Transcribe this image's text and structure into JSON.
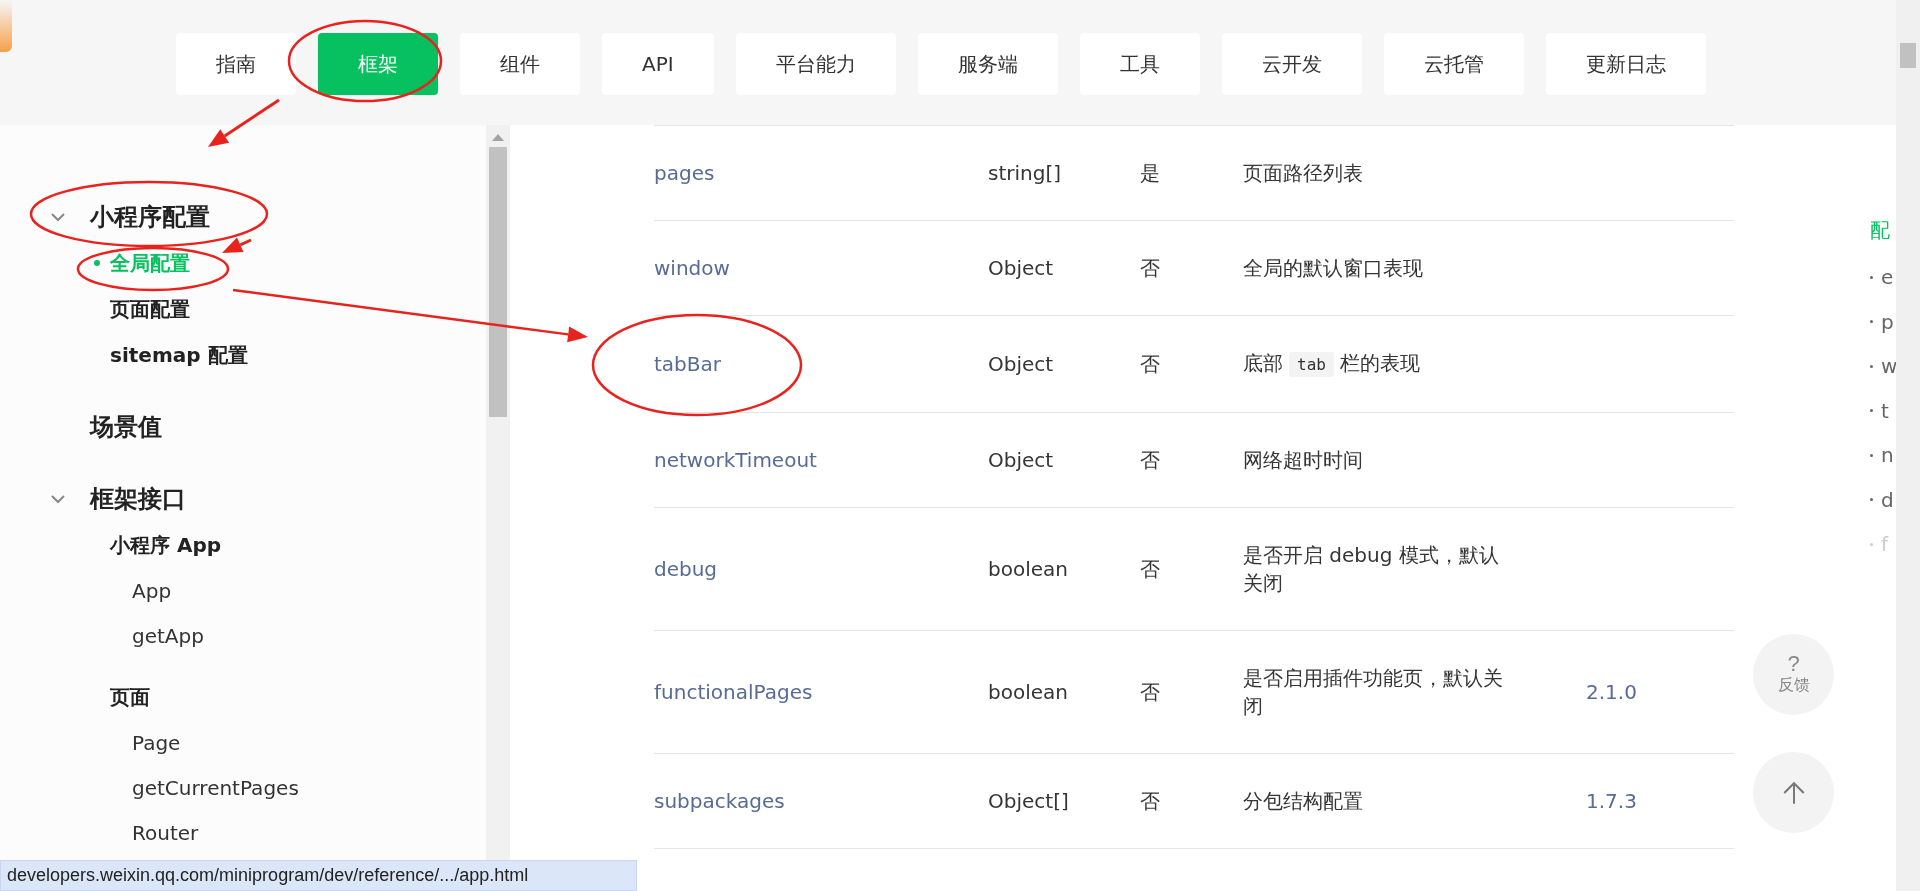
{
  "nav": {
    "tabs": [
      {
        "label": "指南",
        "selected": false
      },
      {
        "label": "框架",
        "selected": true
      },
      {
        "label": "组件",
        "selected": false
      },
      {
        "label": "API",
        "selected": false
      },
      {
        "label": "平台能力",
        "selected": false
      },
      {
        "label": "服务端",
        "selected": false
      },
      {
        "label": "工具",
        "selected": false
      },
      {
        "label": "云开发",
        "selected": false
      },
      {
        "label": "云托管",
        "selected": false
      },
      {
        "label": "更新日志",
        "selected": false
      }
    ]
  },
  "sidebar": {
    "sections": [
      {
        "label": "小程序配置",
        "kind": "folder",
        "expanded": true,
        "children": [
          {
            "label": "全局配置",
            "selected": true
          },
          {
            "label": "页面配置",
            "selected": false
          },
          {
            "label": "sitemap 配置",
            "selected": false
          }
        ]
      },
      {
        "label": "场景值",
        "kind": "page"
      },
      {
        "label": "框架接口",
        "kind": "folder",
        "expanded": true,
        "children": [
          {
            "label": "小程序 App",
            "selected": false,
            "children": [
              {
                "label": "App",
                "selected": false
              },
              {
                "label": "getApp",
                "selected": false
              }
            ]
          },
          {
            "label": "页面",
            "selected": false,
            "children": [
              {
                "label": "Page",
                "selected": false
              },
              {
                "label": "getCurrentPages",
                "selected": false
              },
              {
                "label": "Router",
                "selected": false
              }
            ]
          }
        ]
      }
    ]
  },
  "table": {
    "rows": [
      {
        "name": "pages",
        "type": "string[]",
        "required": "是",
        "description": [
          {
            "kind": "text",
            "text": "页面路径列表"
          }
        ]
      },
      {
        "name": "window",
        "type": "Object",
        "required": "否",
        "description": [
          {
            "kind": "text",
            "text": "全局的默认窗口表现"
          }
        ]
      },
      {
        "name": "tabBar",
        "type": "Object",
        "required": "否",
        "description": [
          {
            "kind": "text",
            "text": "底部"
          },
          {
            "kind": "code",
            "text": "tab"
          },
          {
            "kind": "text",
            "text": "栏的表现"
          }
        ]
      },
      {
        "name": "networkTimeout",
        "type": "Object",
        "required": "否",
        "description": [
          {
            "kind": "text",
            "text": "网络超时时间"
          }
        ]
      },
      {
        "name": "debug",
        "type": "boolean",
        "required": "否",
        "description": [
          {
            "kind": "text",
            "text": "是否开启 debug 模式，默认关闭"
          }
        ]
      },
      {
        "name": "functionalPages",
        "type": "boolean",
        "required": "否",
        "description": [
          {
            "kind": "text",
            "text": "是否启用插件功能页，默认关闭"
          }
        ],
        "version": "2.1.0"
      },
      {
        "name": "subpackages",
        "type": "Object[]",
        "required": "否",
        "description": [
          {
            "kind": "text",
            "text": "分包结构配置"
          }
        ],
        "version": "1.7.3"
      }
    ]
  },
  "toc": {
    "title": "配",
    "items": [
      {
        "label": "e",
        "dimmed": false
      },
      {
        "label": "p",
        "dimmed": false
      },
      {
        "label": "w",
        "dimmed": false
      },
      {
        "label": "t",
        "dimmed": false
      },
      {
        "label": "n",
        "dimmed": false
      },
      {
        "label": "d",
        "dimmed": false
      },
      {
        "label": "f",
        "dimmed": true
      }
    ]
  },
  "float_buttons": {
    "feedback": {
      "icon": "?",
      "label": "反馈"
    }
  },
  "status_bar": {
    "url": "developers.weixin.qq.com/miniprogram/dev/reference/.../app.html"
  }
}
